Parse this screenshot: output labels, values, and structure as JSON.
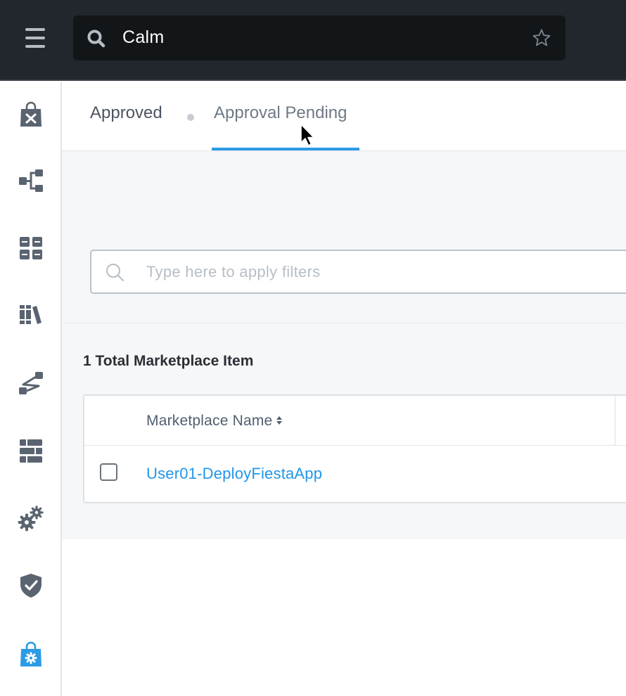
{
  "topbar": {
    "app_name": "Calm",
    "menu_icon": "hamburger-menu-icon",
    "search_icon": "search-icon",
    "favorite_icon": "star-icon"
  },
  "sidebar": {
    "items": [
      {
        "icon": "marketplace-bag-x-icon",
        "active": false
      },
      {
        "icon": "blueprint-tree-icon",
        "active": false
      },
      {
        "icon": "applications-grid-icon",
        "active": false
      },
      {
        "icon": "library-books-icon",
        "active": false
      },
      {
        "icon": "runbooks-path-icon",
        "active": false
      },
      {
        "icon": "endpoints-server-icon",
        "active": false
      },
      {
        "icon": "settings-gears-icon",
        "active": false
      },
      {
        "icon": "policies-shield-icon",
        "active": false
      },
      {
        "icon": "marketplace-manager-bag-gear-icon",
        "active": true
      }
    ],
    "active_color": "#2b9be6",
    "inactive_color": "#5a6470"
  },
  "tabs": {
    "approved": "Approved",
    "approval_pending": "Approval Pending",
    "selected": "approval_pending"
  },
  "filter": {
    "placeholder": "Type here to apply filters",
    "value": ""
  },
  "summary": {
    "total_label": "1 Total Marketplace Item"
  },
  "table": {
    "columns": [
      "Marketplace Name"
    ],
    "rows": [
      {
        "name": "User01-DeployFiestaApp",
        "checked": false
      }
    ]
  },
  "colors": {
    "topbar": "#22272e",
    "accent": "#2b9be6",
    "link": "#2196e8"
  }
}
